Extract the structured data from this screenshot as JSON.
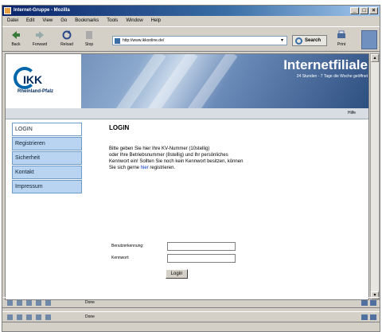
{
  "window": {
    "title": "Internet-Gruppe - Mozilla",
    "controls": [
      "_",
      "□",
      "×"
    ]
  },
  "menu": [
    "Datei",
    "Edit",
    "View",
    "Go",
    "Bookmarks",
    "Tools",
    "Window",
    "Help"
  ],
  "toolbar": {
    "back": "Back",
    "forward": "Forward",
    "reload": "Reload",
    "stop": "Stop",
    "url": "http://www.ikkonline.de/",
    "search": "Search",
    "print": "Print"
  },
  "banner": {
    "logo_text": "IKK",
    "logo_sub": "Rheinland-Pfalz",
    "title": "Internetfiliale",
    "subtitle": "24 Stunden - 7 Tage die Woche geöffnet"
  },
  "subbar": {
    "help": "Hilfe"
  },
  "nav": [
    "LOGIN",
    "Registrieren",
    "Sicherheit",
    "Kontakt",
    "Impressum"
  ],
  "main": {
    "title": "LOGIN",
    "intro_1": "Bitte geben Sie hier Ihre KV-Nummer (10stellig)",
    "intro_2": "oder Ihre Betriebsnummer (8stellig) und Ihr persönliches",
    "intro_3": "Kennwort ein! Sollten Sie noch kein Kennwort besitzen, können",
    "intro_4_pre": "Sie sich gerne",
    "intro_4_link": "hier",
    "intro_4_post": "registrieren.",
    "user_label": "Benutzerkennung:",
    "pass_label": "Kennwort:",
    "login_button": "Login"
  },
  "statusbars": [
    {
      "text": "Done"
    },
    {
      "text": "Done"
    }
  ]
}
